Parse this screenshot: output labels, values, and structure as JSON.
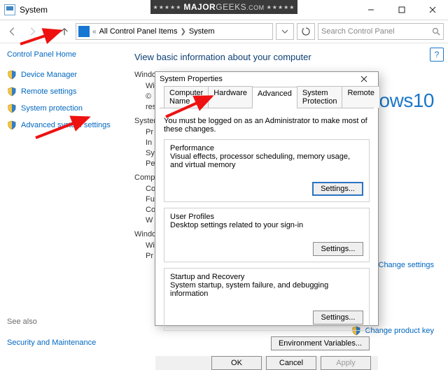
{
  "titlebar": {
    "title": "System"
  },
  "nav": {
    "breadcrumb_prefix": "«",
    "breadcrumb_1": "All Control Panel Items",
    "breadcrumb_2": "System",
    "search_placeholder": "Search Control Panel"
  },
  "sidebar": {
    "home": "Control Panel Home",
    "links": [
      "Device Manager",
      "Remote settings",
      "System protection",
      "Advanced system settings"
    ],
    "seealso_label": "See also",
    "seealso_link": "Security and Maintenance"
  },
  "content": {
    "heading": "View basic information about your computer",
    "brand_prefix": "Windows",
    "brand_suffix": "10",
    "section_windows": "Windows edition",
    "rows_w": [
      "Wi",
      "©",
      "res"
    ],
    "section_system": "System",
    "rows_s": [
      "Pr",
      "In",
      "Sy",
      "Pe"
    ],
    "section_comp": "Computer name, domain, and workgroup settings",
    "rows_c": [
      "Co",
      "Fu",
      "Co",
      "W"
    ],
    "section_act": "Windows activation",
    "rows_a": [
      "Wi",
      "Pr"
    ],
    "right_link1": "Change settings",
    "right_link2": "Change product key",
    "help": "?"
  },
  "dialog": {
    "title": "System Properties",
    "tabs": [
      "Computer Name",
      "Hardware",
      "Advanced",
      "System Protection",
      "Remote"
    ],
    "info": "You must be logged on as an Administrator to make most of these changes.",
    "group_perf_title": "Performance",
    "group_perf_desc": "Visual effects, processor scheduling, memory usage, and virtual memory",
    "group_up_title": "User Profiles",
    "group_up_desc": "Desktop settings related to your sign-in",
    "group_sr_title": "Startup and Recovery",
    "group_sr_desc": "System startup, system failure, and debugging information",
    "btn_settings": "Settings...",
    "btn_env": "Environment Variables...",
    "btn_ok": "OK",
    "btn_cancel": "Cancel",
    "btn_apply": "Apply"
  },
  "watermark": {
    "text_a": "MAJOR",
    "text_b": "GEEKS",
    "text_c": ".COM",
    "stars": "★★★★★"
  }
}
